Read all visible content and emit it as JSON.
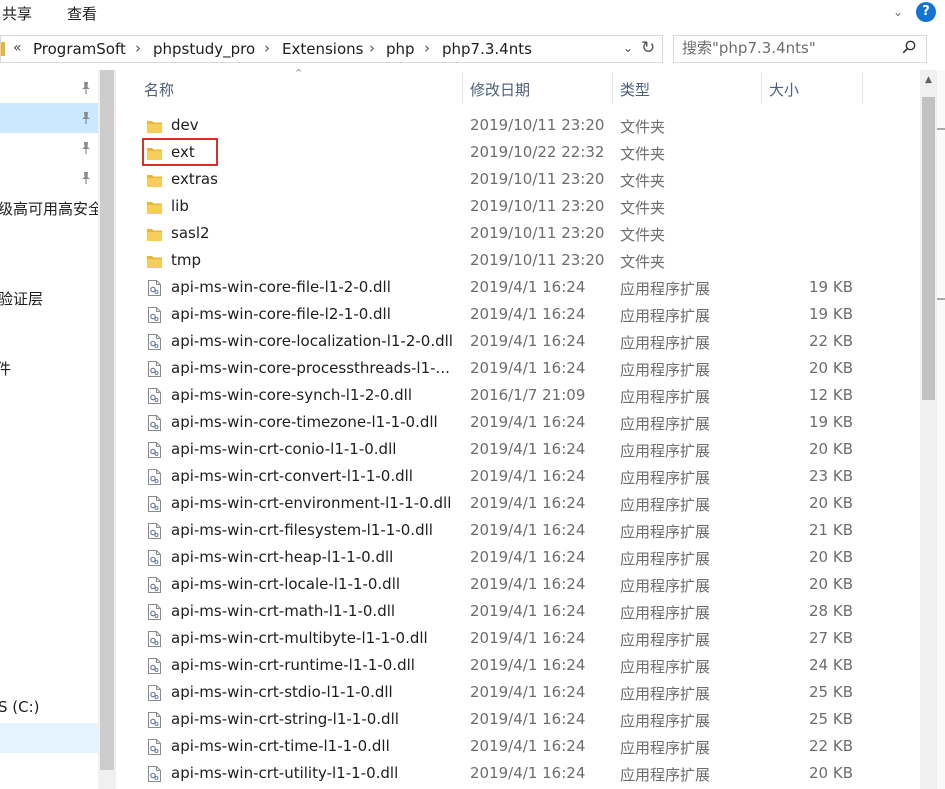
{
  "ribbon": {
    "tabs": [
      "共享",
      "查看"
    ]
  },
  "address": {
    "overflow": "«",
    "crumbs": [
      "ProgramSoft",
      "phpstudy_pro",
      "Extensions",
      "php",
      "php7.3.4nts"
    ],
    "separator": "›"
  },
  "search": {
    "placeholder": "搜索\"php7.3.4nts\""
  },
  "nav": {
    "items": [
      {
        "label": "",
        "pinned": true
      },
      {
        "label": "",
        "pinned": true,
        "selected": true
      },
      {
        "label": "",
        "pinned": true
      },
      {
        "label": "",
        "pinned": true
      },
      {
        "label": "级高可用高安全"
      },
      {
        "label": "验证层"
      },
      {
        "label": "件"
      },
      {
        "label": "S (C:)"
      }
    ]
  },
  "columns": {
    "name": "名称",
    "date": "修改日期",
    "type": "类型",
    "size": "大小"
  },
  "files": [
    {
      "name": "dev",
      "date": "2019/10/11 23:20",
      "type": "文件夹",
      "size": "",
      "kind": "folder"
    },
    {
      "name": "ext",
      "date": "2019/10/22 22:32",
      "type": "文件夹",
      "size": "",
      "kind": "folder"
    },
    {
      "name": "extras",
      "date": "2019/10/11 23:20",
      "type": "文件夹",
      "size": "",
      "kind": "folder"
    },
    {
      "name": "lib",
      "date": "2019/10/11 23:20",
      "type": "文件夹",
      "size": "",
      "kind": "folder"
    },
    {
      "name": "sasl2",
      "date": "2019/10/11 23:20",
      "type": "文件夹",
      "size": "",
      "kind": "folder"
    },
    {
      "name": "tmp",
      "date": "2019/10/11 23:20",
      "type": "文件夹",
      "size": "",
      "kind": "folder"
    },
    {
      "name": "api-ms-win-core-file-l1-2-0.dll",
      "date": "2019/4/1 16:24",
      "type": "应用程序扩展",
      "size": "19 KB",
      "kind": "dll"
    },
    {
      "name": "api-ms-win-core-file-l2-1-0.dll",
      "date": "2019/4/1 16:24",
      "type": "应用程序扩展",
      "size": "19 KB",
      "kind": "dll"
    },
    {
      "name": "api-ms-win-core-localization-l1-2-0.dll",
      "date": "2019/4/1 16:24",
      "type": "应用程序扩展",
      "size": "22 KB",
      "kind": "dll"
    },
    {
      "name": "api-ms-win-core-processthreads-l1-...",
      "date": "2019/4/1 16:24",
      "type": "应用程序扩展",
      "size": "20 KB",
      "kind": "dll"
    },
    {
      "name": "api-ms-win-core-synch-l1-2-0.dll",
      "date": "2016/1/7 21:09",
      "type": "应用程序扩展",
      "size": "12 KB",
      "kind": "dll"
    },
    {
      "name": "api-ms-win-core-timezone-l1-1-0.dll",
      "date": "2019/4/1 16:24",
      "type": "应用程序扩展",
      "size": "19 KB",
      "kind": "dll"
    },
    {
      "name": "api-ms-win-crt-conio-l1-1-0.dll",
      "date": "2019/4/1 16:24",
      "type": "应用程序扩展",
      "size": "20 KB",
      "kind": "dll"
    },
    {
      "name": "api-ms-win-crt-convert-l1-1-0.dll",
      "date": "2019/4/1 16:24",
      "type": "应用程序扩展",
      "size": "23 KB",
      "kind": "dll"
    },
    {
      "name": "api-ms-win-crt-environment-l1-1-0.dll",
      "date": "2019/4/1 16:24",
      "type": "应用程序扩展",
      "size": "20 KB",
      "kind": "dll"
    },
    {
      "name": "api-ms-win-crt-filesystem-l1-1-0.dll",
      "date": "2019/4/1 16:24",
      "type": "应用程序扩展",
      "size": "21 KB",
      "kind": "dll"
    },
    {
      "name": "api-ms-win-crt-heap-l1-1-0.dll",
      "date": "2019/4/1 16:24",
      "type": "应用程序扩展",
      "size": "20 KB",
      "kind": "dll"
    },
    {
      "name": "api-ms-win-crt-locale-l1-1-0.dll",
      "date": "2019/4/1 16:24",
      "type": "应用程序扩展",
      "size": "20 KB",
      "kind": "dll"
    },
    {
      "name": "api-ms-win-crt-math-l1-1-0.dll",
      "date": "2019/4/1 16:24",
      "type": "应用程序扩展",
      "size": "28 KB",
      "kind": "dll"
    },
    {
      "name": "api-ms-win-crt-multibyte-l1-1-0.dll",
      "date": "2019/4/1 16:24",
      "type": "应用程序扩展",
      "size": "27 KB",
      "kind": "dll"
    },
    {
      "name": "api-ms-win-crt-runtime-l1-1-0.dll",
      "date": "2019/4/1 16:24",
      "type": "应用程序扩展",
      "size": "24 KB",
      "kind": "dll"
    },
    {
      "name": "api-ms-win-crt-stdio-l1-1-0.dll",
      "date": "2019/4/1 16:24",
      "type": "应用程序扩展",
      "size": "25 KB",
      "kind": "dll"
    },
    {
      "name": "api-ms-win-crt-string-l1-1-0.dll",
      "date": "2019/4/1 16:24",
      "type": "应用程序扩展",
      "size": "25 KB",
      "kind": "dll"
    },
    {
      "name": "api-ms-win-crt-time-l1-1-0.dll",
      "date": "2019/4/1 16:24",
      "type": "应用程序扩展",
      "size": "22 KB",
      "kind": "dll"
    },
    {
      "name": "api-ms-win-crt-utility-l1-1-0.dll",
      "date": "2019/4/1 16:24",
      "type": "应用程序扩展",
      "size": "20 KB",
      "kind": "dll"
    }
  ],
  "colors": {
    "highlight": "#d8302c",
    "selection": "#cce8ff",
    "folder": "#e8b537",
    "header_text": "#4c607a"
  }
}
